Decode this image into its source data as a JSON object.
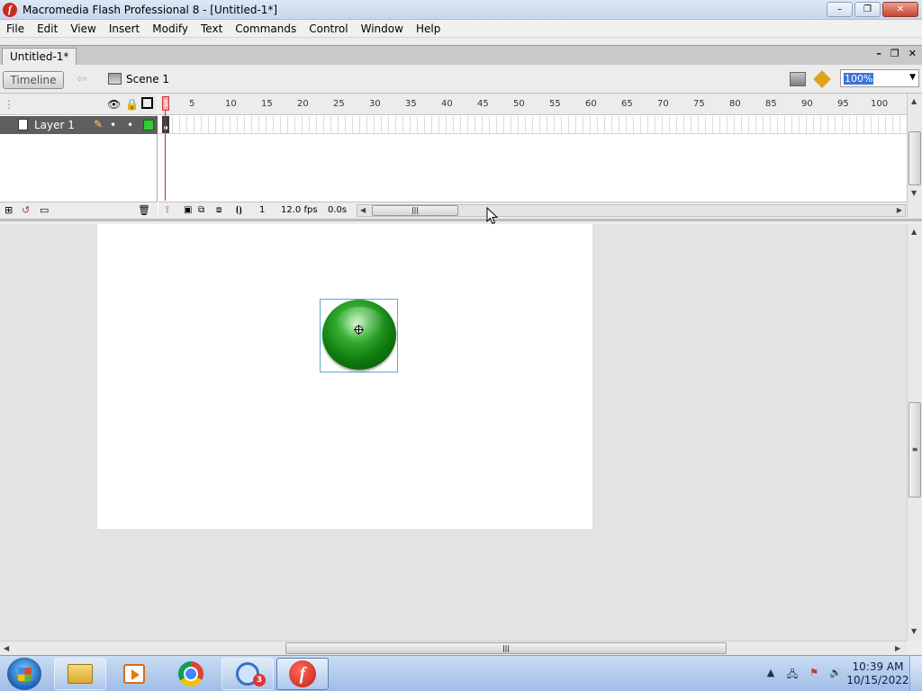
{
  "window": {
    "title": "Macromedia Flash Professional 8 - [Untitled-1*]",
    "controls": {
      "minimize": "–",
      "maximize": "❐",
      "close": "✕"
    }
  },
  "menu": [
    "File",
    "Edit",
    "View",
    "Insert",
    "Modify",
    "Text",
    "Commands",
    "Control",
    "Window",
    "Help"
  ],
  "document": {
    "tab_label": "Untitled-1*",
    "controls": {
      "minimize": "–",
      "restore": "❐",
      "close": "✕"
    }
  },
  "editbar": {
    "timeline_label": "Timeline",
    "scene_label": "Scene 1",
    "zoom": "100%"
  },
  "timeline": {
    "ruler_ticks": [
      "1",
      "5",
      "10",
      "15",
      "20",
      "25",
      "30",
      "35",
      "40",
      "45",
      "50",
      "55",
      "60",
      "65",
      "70",
      "75",
      "80",
      "85",
      "90",
      "95",
      "100"
    ],
    "layer": {
      "name": "Layer 1",
      "outline_color": "#33cc33"
    },
    "current_frame": "1",
    "frame_rate": "12.0 fps",
    "elapsed_time": "0.0s"
  },
  "stage": {
    "background": "#ffffff",
    "symbol": "green-round-button"
  },
  "taskbar": {
    "apps": [
      "windows-explorer",
      "media-player",
      "chrome",
      "magnifier",
      "macromedia-flash"
    ],
    "magnifier_badge": "3",
    "clock_time": "10:39 AM",
    "clock_date": "10/15/2022"
  }
}
